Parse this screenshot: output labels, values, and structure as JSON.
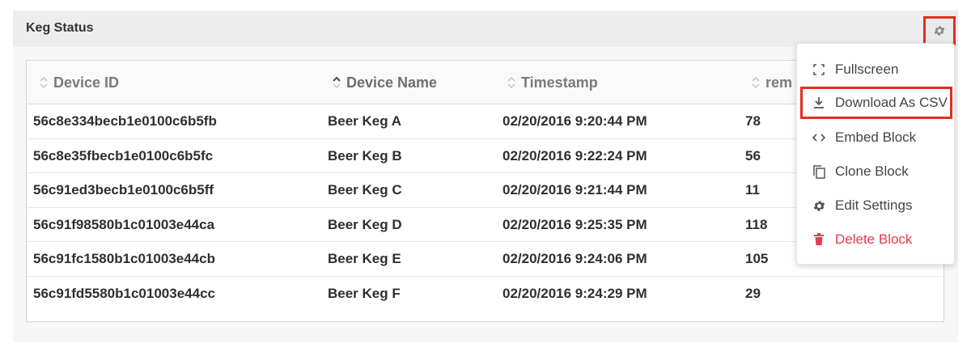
{
  "panel": {
    "title": "Keg Status"
  },
  "table": {
    "columns": [
      "Device ID",
      "Device Name",
      "Timestamp",
      "rem"
    ],
    "rows": [
      [
        "56c8e334becb1e0100c6b5fb",
        "Beer Keg A",
        "02/20/2016 9:20:44 PM",
        "78"
      ],
      [
        "56c8e35fbecb1e0100c6b5fc",
        "Beer Keg B",
        "02/20/2016 9:22:24 PM",
        "56"
      ],
      [
        "56c91ed3becb1e0100c6b5ff",
        "Beer Keg C",
        "02/20/2016 9:21:44 PM",
        "11"
      ],
      [
        "56c91f98580b1c01003e44ca",
        "Beer Keg D",
        "02/20/2016 9:25:35 PM",
        "118"
      ],
      [
        "56c91fc1580b1c01003e44cb",
        "Beer Keg E",
        "02/20/2016 9:24:06 PM",
        "105"
      ],
      [
        "56c91fd5580b1c01003e44cc",
        "Beer Keg F",
        "02/20/2016 9:24:29 PM",
        "29"
      ]
    ]
  },
  "menu": {
    "items": [
      {
        "label": "Fullscreen",
        "icon": "fullscreen-icon"
      },
      {
        "label": "Download As CSV",
        "icon": "download-icon"
      },
      {
        "label": "Embed Block",
        "icon": "code-icon"
      },
      {
        "label": "Clone Block",
        "icon": "copy-icon"
      },
      {
        "label": "Edit Settings",
        "icon": "gear-icon"
      },
      {
        "label": "Delete Block",
        "icon": "trash-icon"
      }
    ]
  },
  "colors": {
    "highlight": "#e0301e",
    "danger": "#e8394e",
    "header_bg": "#ededed"
  }
}
